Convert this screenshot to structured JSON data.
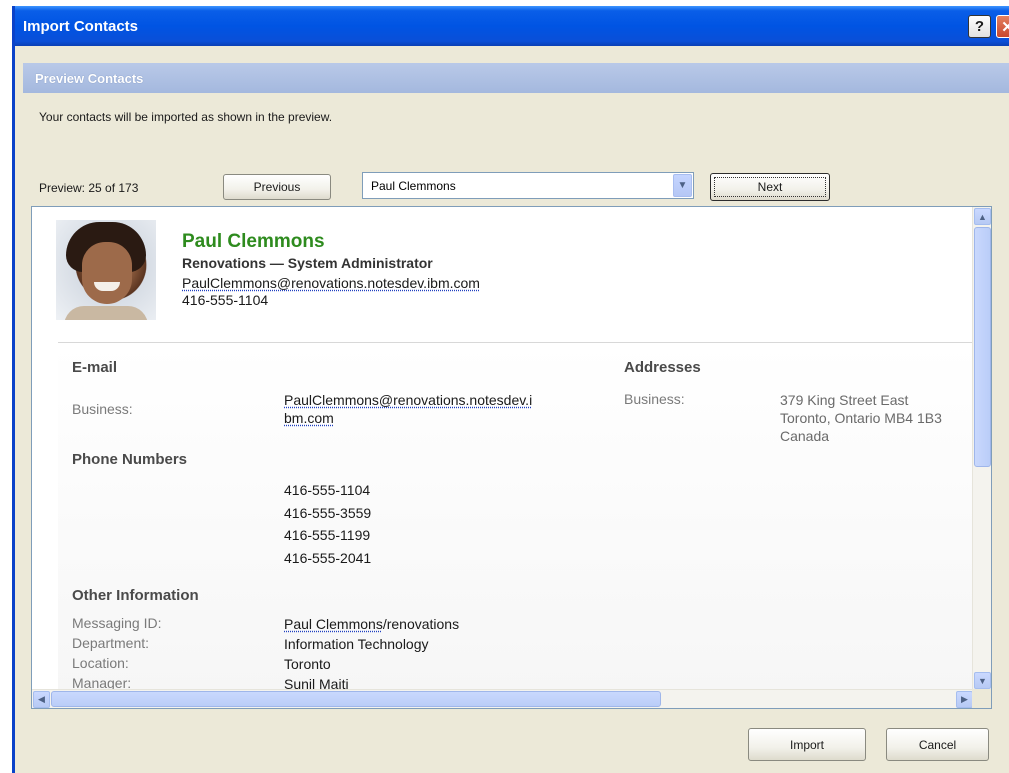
{
  "window": {
    "title": "Import Contacts",
    "help_glyph": "?",
    "close_glyph": "✕"
  },
  "section": {
    "title": "Preview Contacts",
    "intro": "Your contacts will be imported as shown in the preview."
  },
  "navigation": {
    "preview_label": "Preview: 25 of 173",
    "previous_label": "Previous",
    "next_label": "Next",
    "selected_contact": "Paul Clemmons"
  },
  "contact": {
    "name": "Paul Clemmons",
    "company_title": "Renovations  —  System Administrator",
    "email": "PaulClemmons@renovations.notesdev.ibm.com",
    "phone": "416-555-1104"
  },
  "email_section": {
    "title": "E-mail",
    "label": "Business:",
    "value_line1": "PaulClemmons@renovations.notesdev.i",
    "value_line2": "bm.com"
  },
  "addresses_section": {
    "title": "Addresses",
    "label": "Business:",
    "line1": "379 King Street East",
    "line2": "Toronto, Ontario  MB4 1B3",
    "line3": "Canada"
  },
  "phones_section": {
    "title": "Phone Numbers",
    "numbers": [
      "416-555-1104",
      "416-555-3559",
      "416-555-1199",
      "416-555-2041"
    ]
  },
  "other_section": {
    "title": "Other Information",
    "rows": [
      {
        "label": "Messaging ID:",
        "value_link": "Paul Clemmons",
        "value_rest": "/renovations"
      },
      {
        "label": "Department:",
        "value": "Information Technology"
      },
      {
        "label": "Location:",
        "value": "Toronto"
      },
      {
        "label": "Manager:",
        "value_link": "Sunil Maiti"
      }
    ]
  },
  "footer": {
    "import_label": "Import",
    "cancel_label": "Cancel"
  },
  "colors": {
    "titlebar": "#0054e3",
    "contact_name": "#2e8b1e",
    "section_header": "#a4b8de"
  }
}
